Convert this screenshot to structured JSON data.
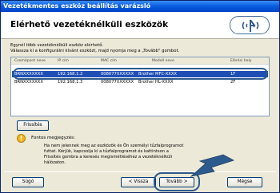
{
  "window": {
    "title": "Vezetékmentes eszköz beállítás varázsló"
  },
  "header": {
    "title": "Elérhető vezetéknélküli eszközök"
  },
  "description": {
    "line1": "Egynél több vezetéknélküli eszköz elérhető.",
    "line2": "Válassza ki a konfigurálni kívánt eszközt, majd nyomja meg a „Tovább\" gombot."
  },
  "device_list": {
    "columns": [
      "Csomópont neve",
      "IP cím",
      "MAC cím",
      "Modell neve",
      "Elérési hely"
    ],
    "rows": [
      {
        "node": "BRNXXXXXXX",
        "ip": "192.168.1.2",
        "mac": "008077XXXXXX",
        "model": "Brother MFC-XXXX",
        "location": "1F",
        "selected": true
      },
      {
        "node": "BRNXXXXXXX",
        "ip": "192.168.1.3",
        "mac": "008077XXXXXX",
        "model": "Brother HL-XXXX",
        "location": "2F",
        "selected": false
      }
    ]
  },
  "buttons": {
    "refresh": "Frissítés",
    "help": "Súgó",
    "back": "< Vissza",
    "next": "Tovább >",
    "cancel": "Mégse"
  },
  "note": {
    "title": "Fontos megjegyzés:",
    "line1": "Ha nem jelennek meg az eszközök és Ön személyi tűzfalprogramot",
    "line2": "futtat. Kérjük, kapcsolja ki a tűzfalprogramot és kattintson a",
    "line3": "Frissítés gombra a keresés megismétléséhez a vezetéknélküli",
    "line4": "hálózaton."
  },
  "colors": {
    "highlight": "#1f4fb5",
    "annotation": "#2d5a8c",
    "titlebar": "#0a5fe0"
  }
}
